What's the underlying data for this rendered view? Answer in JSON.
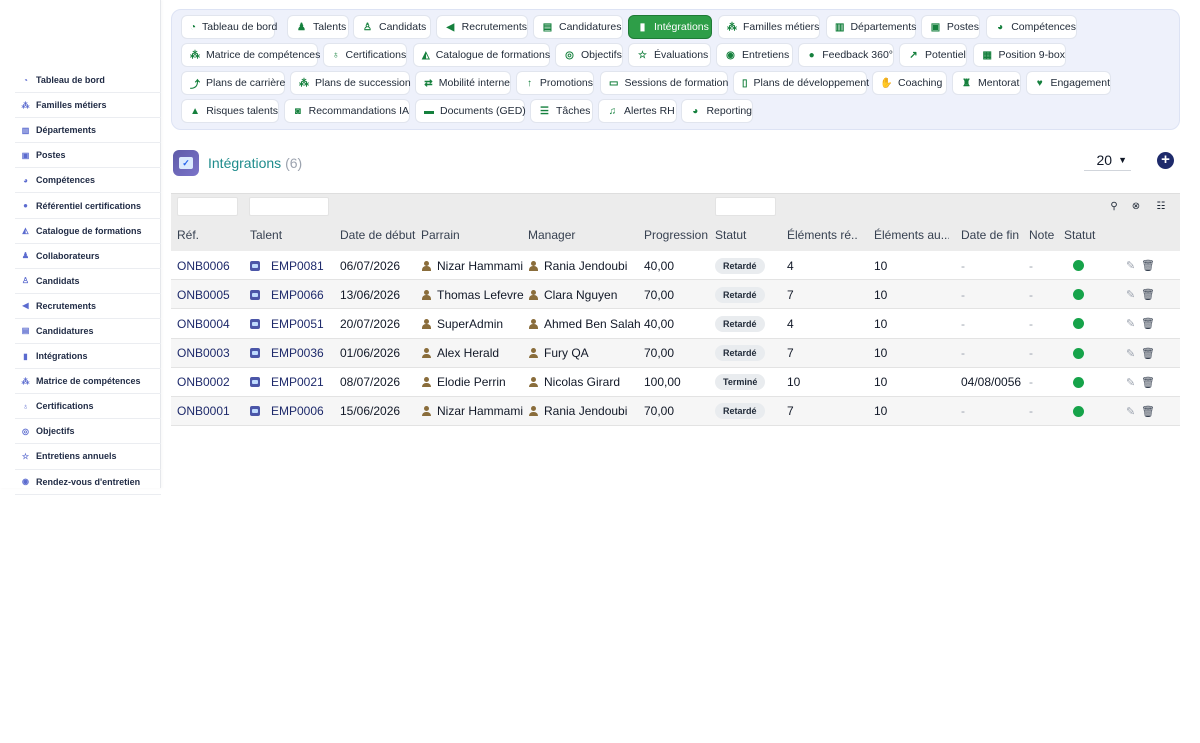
{
  "sidebar": {
    "items": [
      {
        "label": "Tableau de bord",
        "icon": "dashboard-icon",
        "glyph": "◔"
      },
      {
        "label": "Familles métiers",
        "icon": "sitemap-icon",
        "glyph": "⁂"
      },
      {
        "label": "Départements",
        "icon": "building-icon",
        "glyph": "▥"
      },
      {
        "label": "Postes",
        "icon": "id-badge-icon",
        "glyph": "▣"
      },
      {
        "label": "Compétences",
        "icon": "brain-icon",
        "glyph": "◕"
      },
      {
        "label": "Référentiel certifications",
        "icon": "certificate-icon",
        "glyph": "●"
      },
      {
        "label": "Catalogue de formations",
        "icon": "graduation-cap-icon",
        "glyph": "◭"
      },
      {
        "label": "Collaborateurs",
        "icon": "user-icon",
        "glyph": "♟"
      },
      {
        "label": "Candidats",
        "icon": "user-plus-icon",
        "glyph": "♙"
      },
      {
        "label": "Recrutements",
        "icon": "bullhorn-icon",
        "glyph": "◀"
      },
      {
        "label": "Candidatures",
        "icon": "file-signature-icon",
        "glyph": "▤"
      },
      {
        "label": "Intégrations",
        "icon": "door-open-icon",
        "glyph": "▮"
      },
      {
        "label": "Matrice de compétences",
        "icon": "network-icon",
        "glyph": "⁂"
      },
      {
        "label": "Certifications",
        "icon": "award-icon",
        "glyph": "♁"
      },
      {
        "label": "Objectifs",
        "icon": "target-icon",
        "glyph": "◎"
      },
      {
        "label": "Entretiens annuels",
        "icon": "star-icon",
        "glyph": "☆"
      },
      {
        "label": "Rendez-vous d'entretien",
        "icon": "comments-icon",
        "glyph": "◉"
      }
    ]
  },
  "modules": [
    {
      "label": "Tableau de bord",
      "icon": "dashboard-icon",
      "glyph": "◔",
      "active": false
    },
    {
      "label": "Talents",
      "icon": "user-icon",
      "glyph": "♟",
      "active": false
    },
    {
      "label": "Candidats",
      "icon": "user-plus-icon",
      "glyph": "♙",
      "active": false
    },
    {
      "label": "Recrutements",
      "icon": "bullhorn-icon",
      "glyph": "◀",
      "active": false
    },
    {
      "label": "Candidatures",
      "icon": "file-signature-icon",
      "glyph": "▤",
      "active": false
    },
    {
      "label": "Intégrations",
      "icon": "door-open-icon",
      "glyph": "▮",
      "active": true
    },
    {
      "label": "Familles métiers",
      "icon": "sitemap-icon",
      "glyph": "⁂",
      "active": false
    },
    {
      "label": "Départements",
      "icon": "building-icon",
      "glyph": "▥",
      "active": false
    },
    {
      "label": "Postes",
      "icon": "id-badge-icon",
      "glyph": "▣",
      "active": false
    },
    {
      "label": "Compétences",
      "icon": "brain-icon",
      "glyph": "◕",
      "active": false
    },
    {
      "label": "Matrice de compétences",
      "icon": "network-icon",
      "glyph": "⁂",
      "active": false
    },
    {
      "label": "Certifications",
      "icon": "award-icon",
      "glyph": "♁",
      "active": false
    },
    {
      "label": "Catalogue de formations",
      "icon": "graduation-cap-icon",
      "glyph": "◭",
      "active": false
    },
    {
      "label": "Objectifs",
      "icon": "target-icon",
      "glyph": "◎",
      "active": false
    },
    {
      "label": "Évaluations",
      "icon": "star-icon",
      "glyph": "☆",
      "active": false
    },
    {
      "label": "Entretiens",
      "icon": "comments-icon",
      "glyph": "◉",
      "active": false
    },
    {
      "label": "Feedback 360°",
      "icon": "comment-dots-icon",
      "glyph": "●",
      "active": false
    },
    {
      "label": "Potentiel",
      "icon": "chart-line-icon",
      "glyph": "↗",
      "active": false
    },
    {
      "label": "Position 9-box",
      "icon": "grid-icon",
      "glyph": "▦",
      "active": false
    },
    {
      "label": "Plans de carrière",
      "icon": "route-icon",
      "glyph": "⤴",
      "active": false
    },
    {
      "label": "Plans de succession",
      "icon": "sitemap-icon",
      "glyph": "⁂",
      "active": false
    },
    {
      "label": "Mobilité interne",
      "icon": "exchange-icon",
      "glyph": "⇄",
      "active": false
    },
    {
      "label": "Promotions",
      "icon": "arrow-up-icon",
      "glyph": "↑",
      "active": false
    },
    {
      "label": "Sessions de formation",
      "icon": "chalkboard-icon",
      "glyph": "▭",
      "active": false
    },
    {
      "label": "Plans de développement",
      "icon": "clipboard-icon",
      "glyph": "▯",
      "active": false
    },
    {
      "label": "Coaching",
      "icon": "handshake-icon",
      "glyph": "✋",
      "active": false
    },
    {
      "label": "Mentorat",
      "icon": "mentor-icon",
      "glyph": "♜",
      "active": false
    },
    {
      "label": "Engagement",
      "icon": "heart-icon",
      "glyph": "♥",
      "active": false
    },
    {
      "label": "Risques talents",
      "icon": "warning-icon",
      "glyph": "▲",
      "active": false
    },
    {
      "label": "Recommandations IA",
      "icon": "robot-icon",
      "glyph": "◙",
      "active": false
    },
    {
      "label": "Documents (GED)",
      "icon": "folder-open-icon",
      "glyph": "▬",
      "active": false
    },
    {
      "label": "Tâches",
      "icon": "list-check-icon",
      "glyph": "☰",
      "active": false
    },
    {
      "label": "Alertes RH",
      "icon": "bell-icon",
      "glyph": "♫",
      "active": false
    },
    {
      "label": "Reporting",
      "icon": "pie-chart-icon",
      "glyph": "◕",
      "active": false
    }
  ],
  "page": {
    "title": "Intégrations",
    "count": "(6)",
    "page_size": "20",
    "add_symbol": "+"
  },
  "table": {
    "headers": [
      "Réf.",
      "Talent",
      "Date de début",
      "Parrain",
      "Manager",
      "Progression",
      "Statut",
      "Éléments ré...",
      "Éléments au...",
      "Date de fin",
      "Note",
      "Statut"
    ],
    "rows": [
      {
        "ref": "ONB0006",
        "talent": "EMP0081",
        "start": "06/07/2026",
        "parrain": "Nizar Hammami",
        "manager": "Rania Jendoubi",
        "progress": "40,00",
        "status": "Retardé",
        "done": "4",
        "total": "10",
        "end": "-",
        "note": "-"
      },
      {
        "ref": "ONB0005",
        "talent": "EMP0066",
        "start": "13/06/2026",
        "parrain": "Thomas Lefevre",
        "manager": "Clara Nguyen",
        "progress": "70,00",
        "status": "Retardé",
        "done": "7",
        "total": "10",
        "end": "-",
        "note": "-"
      },
      {
        "ref": "ONB0004",
        "talent": "EMP0051",
        "start": "20/07/2026",
        "parrain": "SuperAdmin",
        "manager": "Ahmed Ben Salah",
        "progress": "40,00",
        "status": "Retardé",
        "done": "4",
        "total": "10",
        "end": "-",
        "note": "-"
      },
      {
        "ref": "ONB0003",
        "talent": "EMP0036",
        "start": "01/06/2026",
        "parrain": "Alex Herald",
        "manager": "Fury QA",
        "progress": "70,00",
        "status": "Retardé",
        "done": "7",
        "total": "10",
        "end": "-",
        "note": "-"
      },
      {
        "ref": "ONB0002",
        "talent": "EMP0021",
        "start": "08/07/2026",
        "parrain": "Elodie Perrin",
        "manager": "Nicolas Girard",
        "progress": "100,00",
        "status": "Terminé",
        "done": "10",
        "total": "10",
        "end": "04/08/0056",
        "note": "-"
      },
      {
        "ref": "ONB0001",
        "talent": "EMP0006",
        "start": "15/06/2026",
        "parrain": "Nizar Hammami",
        "manager": "Rania Jendoubi",
        "progress": "70,00",
        "status": "Retardé",
        "done": "7",
        "total": "10",
        "end": "-",
        "note": "-"
      }
    ]
  },
  "icons": {
    "search": "⚲",
    "clear_search": "⊗",
    "list": "☷",
    "edit": "✎",
    "delete": "🗑",
    "chevron": "⌄"
  },
  "colors": {
    "accent_green": "#2e9e48",
    "status_green": "#16a34a",
    "title_teal": "#1f8c8c",
    "navy": "#1e2a6b"
  }
}
